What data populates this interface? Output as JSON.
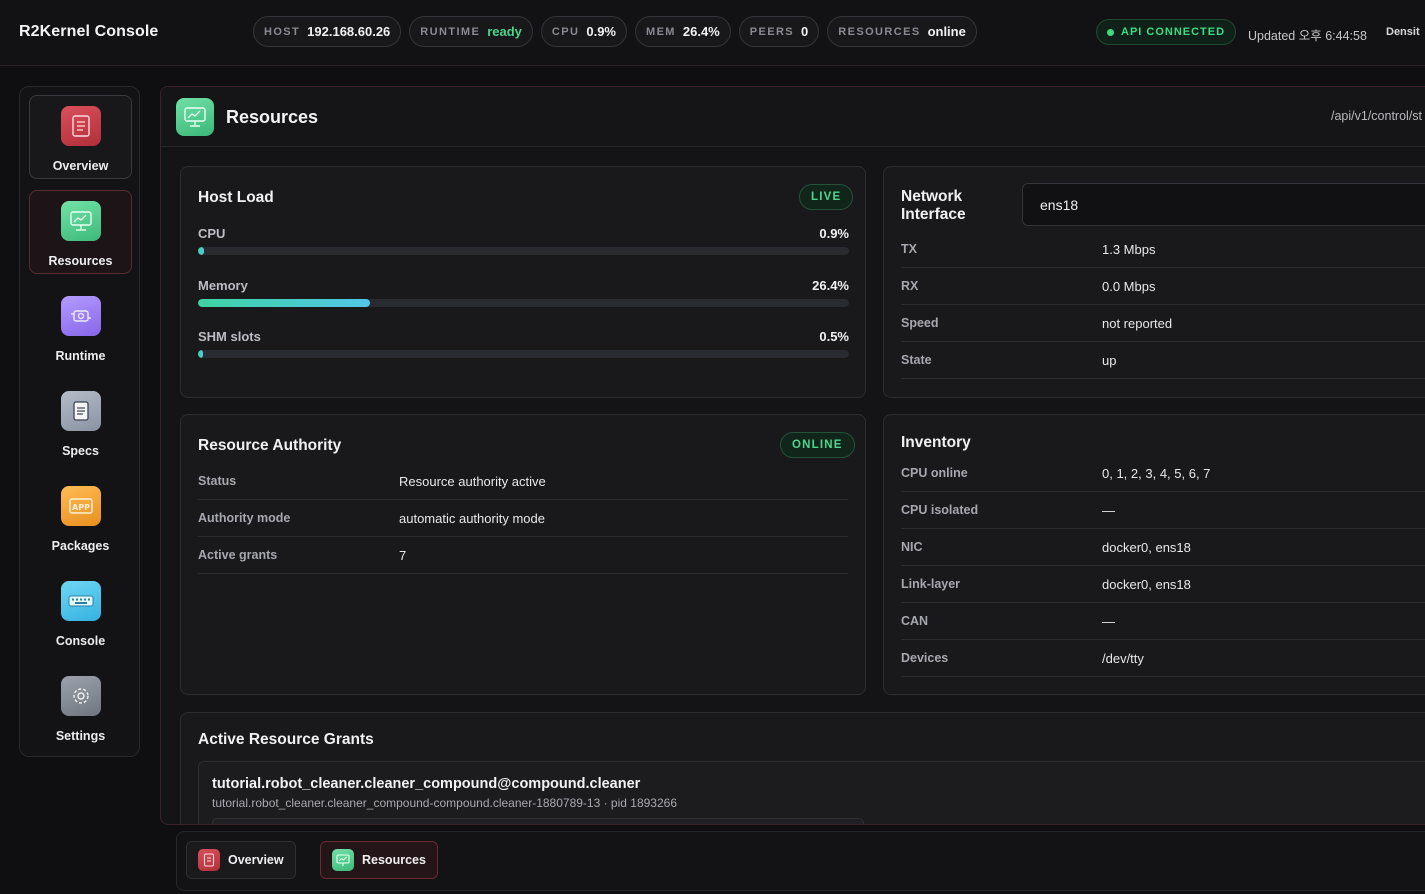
{
  "app": {
    "title": "R2Kernel Console"
  },
  "status_pills": [
    {
      "key": "HOST",
      "value": "192.168.60.26"
    },
    {
      "key": "RUNTIME",
      "value": "ready"
    },
    {
      "key": "CPU",
      "value": "0.9%"
    },
    {
      "key": "MEM",
      "value": "26.4%"
    },
    {
      "key": "PEERS",
      "value": "0"
    },
    {
      "key": "RESOURCES",
      "value": "online"
    }
  ],
  "api": {
    "label": "API CONNECTED",
    "color": "#3ddc84"
  },
  "updated": "Updated 오후 6:44:58",
  "density_label": "Densit",
  "sidebar": {
    "items": [
      {
        "label": "Overview",
        "icon": "document-icon",
        "color": "#c63a45"
      },
      {
        "label": "Resources",
        "icon": "monitor-chart-icon",
        "color": "#4ccb88"
      },
      {
        "label": "Runtime",
        "icon": "engine-icon",
        "color": "#9a7cf0"
      },
      {
        "label": "Specs",
        "icon": "clipboard-icon",
        "color": "#9aa3b2"
      },
      {
        "label": "Packages",
        "icon": "app-icon",
        "color": "#f0a23a"
      },
      {
        "label": "Console",
        "icon": "keyboard-icon",
        "color": "#4cc4ec"
      },
      {
        "label": "Settings",
        "icon": "gear-icon",
        "color": "#8a8f99"
      }
    ]
  },
  "panel": {
    "title": "Resources",
    "path": "/api/v1/control/st"
  },
  "host_load": {
    "title": "Host Load",
    "badge": "LIVE",
    "metrics": [
      {
        "label": "CPU",
        "value": "0.9%",
        "fraction": 0.009
      },
      {
        "label": "Memory",
        "value": "26.4%",
        "fraction": 0.264
      },
      {
        "label": "SHM slots",
        "value": "0.5%",
        "fraction": 0.005
      }
    ]
  },
  "network": {
    "title": "Network Interface",
    "title_line1": "Network",
    "title_line2": "Interface",
    "selected": "ens18",
    "rows": [
      {
        "key": "TX",
        "value": "1.3 Mbps"
      },
      {
        "key": "RX",
        "value": "0.0 Mbps"
      },
      {
        "key": "Speed",
        "value": "not reported"
      },
      {
        "key": "State",
        "value": "up"
      }
    ]
  },
  "authority": {
    "title": "Resource Authority",
    "badge": "ONLINE",
    "rows": [
      {
        "key": "Status",
        "value": "Resource authority active"
      },
      {
        "key": "Authority mode",
        "value": "automatic authority mode"
      },
      {
        "key": "Active grants",
        "value": "7"
      }
    ]
  },
  "inventory": {
    "title": "Inventory",
    "rows": [
      {
        "key": "CPU online",
        "value": "0, 1, 2, 3, 4, 5, 6, 7"
      },
      {
        "key": "CPU isolated",
        "value": "—"
      },
      {
        "key": "NIC",
        "value": "docker0, ens18"
      },
      {
        "key": "Link-layer",
        "value": "docker0, ens18"
      },
      {
        "key": "CAN",
        "value": "—"
      },
      {
        "key": "Devices",
        "value": "/dev/tty"
      }
    ]
  },
  "grants": {
    "title": "Active Resource Grants",
    "items": [
      {
        "name": "tutorial.robot_cleaner.cleaner_compound@compound.cleaner",
        "detail": "tutorial.robot_cleaner.cleaner_compound-compound.cleaner-1880789-13 · pid 1893266"
      }
    ]
  },
  "bottom_tabs": [
    {
      "label": "Overview",
      "icon": "document-icon",
      "color": "#c63a45"
    },
    {
      "label": "Resources",
      "icon": "monitor-chart-icon",
      "color": "#4ccb88"
    }
  ]
}
